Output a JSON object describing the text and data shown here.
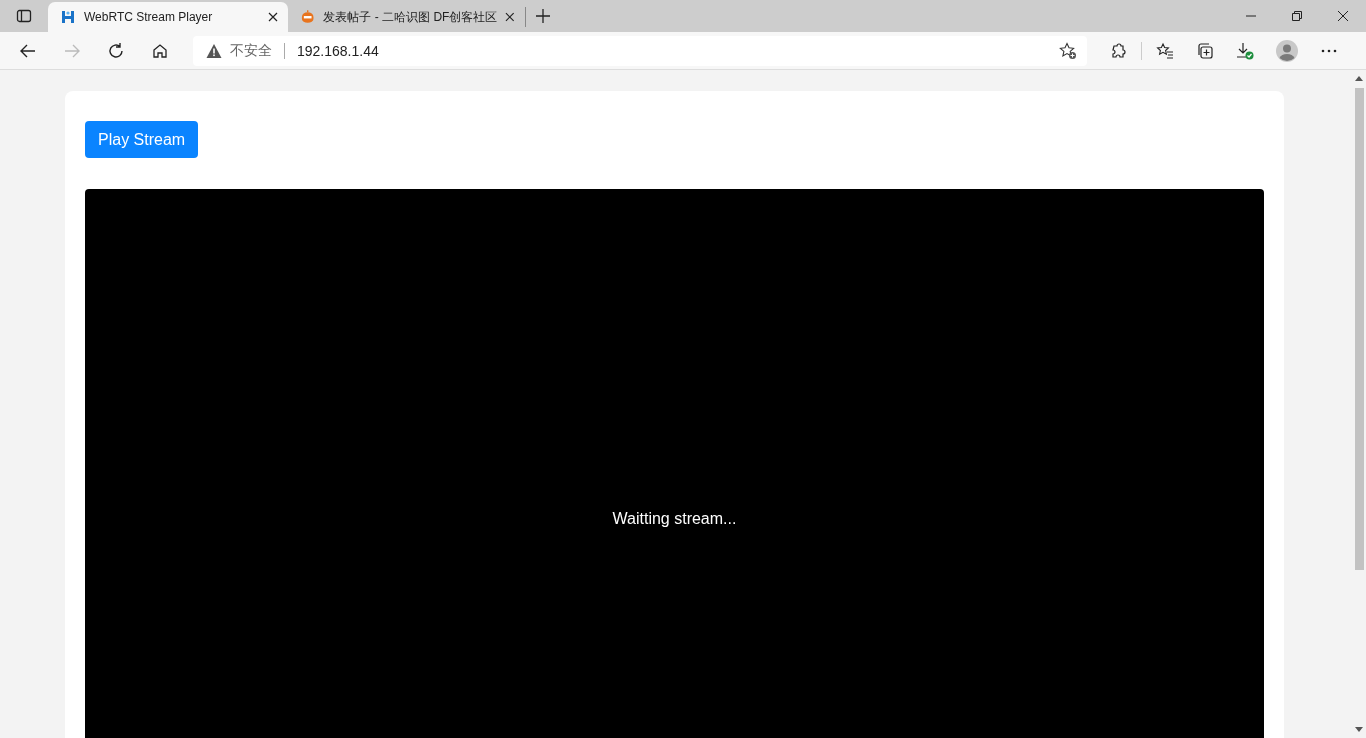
{
  "browser": {
    "tabs": [
      {
        "title": "WebRTC Stream Player",
        "selected": true
      },
      {
        "title": "发表帖子 - 二哈识图 DF创客社区",
        "selected": false
      }
    ],
    "address_bar": {
      "security_label": "不安全",
      "url": "192.168.1.44"
    }
  },
  "page": {
    "button": "Play Stream",
    "video": {
      "status": "Waitting stream..."
    }
  }
}
